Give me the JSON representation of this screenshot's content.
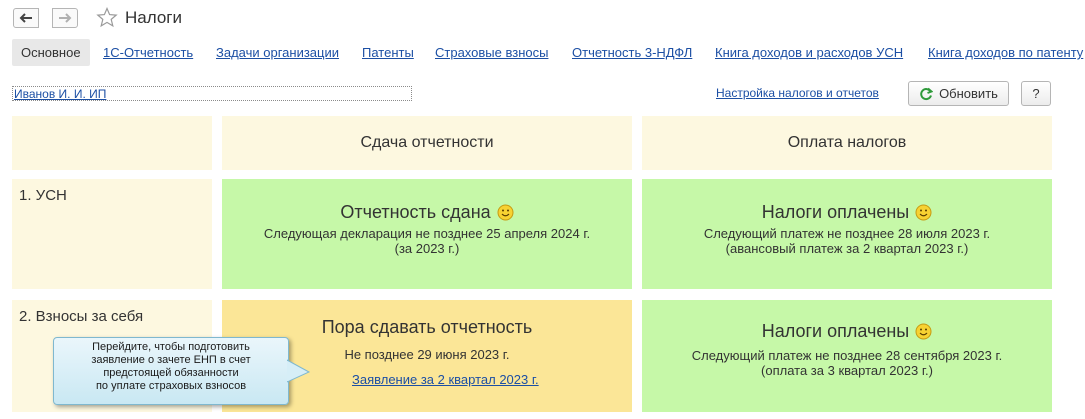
{
  "window": {
    "title": "Налоги"
  },
  "tabs": [
    {
      "label": "Основное"
    },
    {
      "label": "1С-Отчетность"
    },
    {
      "label": "Задачи организации"
    },
    {
      "label": "Патенты"
    },
    {
      "label": "Страховые взносы"
    },
    {
      "label": "Отчетность 3-НДФЛ"
    },
    {
      "label": "Книга доходов и расходов УСН"
    },
    {
      "label": "Книга доходов по патенту"
    }
  ],
  "toolbar": {
    "organization": "Иванов И. И. ИП",
    "settings_link": "Настройка налогов и отчетов",
    "refresh_label": "Обновить",
    "help_label": "?"
  },
  "columns": {
    "reporting": "Сдача отчетности",
    "payment": "Оплата налогов"
  },
  "rows": [
    {
      "label": "1. УСН",
      "reporting": {
        "status": "Отчетность сдана",
        "line1": "Следующая декларация не позднее 25 апреля 2024 г.",
        "line2": "(за 2023 г.)"
      },
      "payment": {
        "status": "Налоги оплачены",
        "line1": "Следующий платеж не позднее 28 июля 2023 г.",
        "line2": "(авансовый платеж за 2 квартал 2023 г.)"
      }
    },
    {
      "label": "2. Взносы за себя",
      "reporting": {
        "status": "Пора сдавать отчетность",
        "line1": "Не позднее 29 июня 2023 г.",
        "link": "Заявление за 2 квартал 2023 г."
      },
      "payment": {
        "status": "Налоги оплачены",
        "line1": "Следующий платеж не позднее 28 сентября 2023 г.",
        "line2": "(оплата за 3 квартал 2023 г.)"
      }
    }
  ],
  "tooltip": {
    "lines": [
      "Перейдите, чтобы подготовить",
      "заявление о зачете ЕНП в счет",
      "предстоящей обязанности",
      "по уплате страховых взносов"
    ]
  },
  "colors": {
    "link": "#1c4fa4",
    "header_bg": "#fdf8e0",
    "ok_bg": "#c6f8a8",
    "warn_bg": "#fbe697",
    "refresh_icon": "#2e9a3a"
  }
}
